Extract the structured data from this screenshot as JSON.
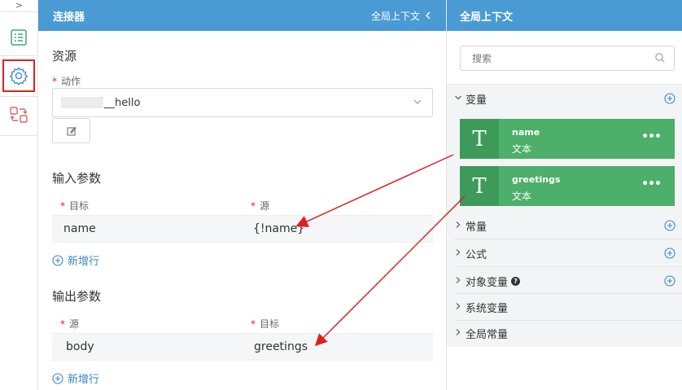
{
  "rail": {
    "collapse_glyph": ">",
    "items": [
      {
        "icon": "list-icon",
        "active": false
      },
      {
        "icon": "gear-icon",
        "active": true
      },
      {
        "icon": "swap-icon",
        "active": false
      }
    ]
  },
  "connector": {
    "title": "连接器",
    "context_link": "全局上下文",
    "resources": {
      "title": "资源",
      "action_label": "动作",
      "action_value": "__hello"
    },
    "input_params": {
      "title": "输入参数",
      "col_target": "目标",
      "col_source": "源",
      "rows": [
        {
          "target": "name",
          "source": "{!name}"
        }
      ],
      "add_row": "新增行"
    },
    "output_params": {
      "title": "输出参数",
      "col_source": "源",
      "col_target": "目标",
      "rows": [
        {
          "source": "body",
          "target": "greetings"
        }
      ],
      "add_row": "新增行"
    }
  },
  "global_context": {
    "title": "全局上下文",
    "search_placeholder": "搜索",
    "variables_label": "变量",
    "variables": [
      {
        "name": "name",
        "type": "文本",
        "icon_letter": "T"
      },
      {
        "name": "greetings",
        "type": "文本",
        "icon_letter": "T"
      }
    ],
    "groups": [
      {
        "label": "常量",
        "has_add": true
      },
      {
        "label": "公式",
        "has_add": true
      },
      {
        "label": "对象变量",
        "has_add": true,
        "has_help": true
      },
      {
        "label": "系统变量",
        "has_add": false
      },
      {
        "label": "全局常量",
        "has_add": false
      }
    ],
    "more_glyph": "•••",
    "help_glyph": "?"
  },
  "colors": {
    "header_blue": "#4a9ad4",
    "card_green": "#4caf6a",
    "card_icon_green": "#3d9a59",
    "link_blue": "#3d86c6",
    "required_red": "#e02020",
    "arrow_red": "#e02020"
  }
}
